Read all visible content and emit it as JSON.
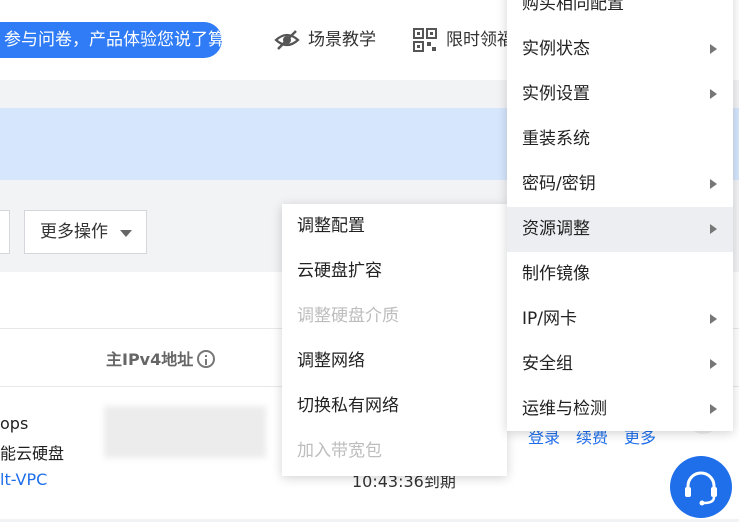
{
  "topbar": {
    "survey_text": "参与问卷，产品体验您说了算",
    "scene_teaching": "场景教学",
    "limited_offer": "限时领福"
  },
  "toolbar": {
    "more_actions": "更多操作"
  },
  "table": {
    "ipv4_header": "主IPv4地址",
    "row": {
      "disk_line1": "ops",
      "disk_line2": "能云硬盘",
      "vpc": "lt-VPC",
      "expiry": "10:43:36到期",
      "actions": [
        "登录",
        "续费",
        "更多"
      ]
    }
  },
  "submenu": {
    "items": [
      {
        "label": "调整配置",
        "disabled": false
      },
      {
        "label": "云硬盘扩容",
        "disabled": false
      },
      {
        "label": "调整硬盘介质",
        "disabled": true
      },
      {
        "label": "调整网络",
        "disabled": false
      },
      {
        "label": "切换私有网络",
        "disabled": false
      },
      {
        "label": "加入带宽包",
        "disabled": true
      }
    ]
  },
  "mainmenu": {
    "items": [
      {
        "label": "购买相同配置",
        "has_submenu": false
      },
      {
        "label": "实例状态",
        "has_submenu": true
      },
      {
        "label": "实例设置",
        "has_submenu": true
      },
      {
        "label": "重装系统",
        "has_submenu": false
      },
      {
        "label": "密码/密钥",
        "has_submenu": true
      },
      {
        "label": "资源调整",
        "has_submenu": true,
        "active": true
      },
      {
        "label": "制作镜像",
        "has_submenu": false
      },
      {
        "label": "IP/网卡",
        "has_submenu": true
      },
      {
        "label": "安全组",
        "has_submenu": true
      },
      {
        "label": "运维与检测",
        "has_submenu": true
      }
    ]
  },
  "icons": {
    "scene": "eye-slash-icon",
    "offer": "qr-code-icon",
    "support": "headset-icon",
    "info": "info-icon"
  },
  "colors": {
    "accent": "#2f7cf6",
    "link": "#1f6feb",
    "notice_bg": "#d6e6fd",
    "disabled": "#bdbdbd"
  }
}
